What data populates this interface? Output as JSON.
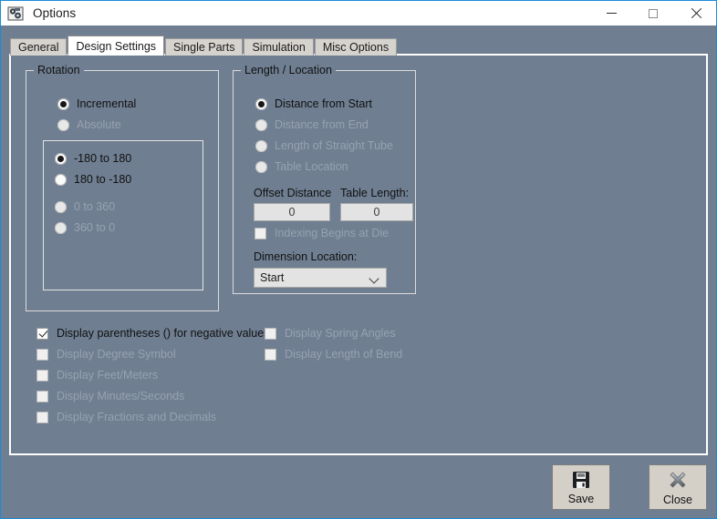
{
  "window": {
    "title": "Options",
    "icon": "machine-gear-icon",
    "controls": {
      "minimize": "minimize-icon",
      "maximize": "maximize-icon",
      "close": "close-icon"
    },
    "border_color": "#1a8cd8",
    "body_color": "#6f7e91"
  },
  "tabs": [
    {
      "label": "General",
      "active": false
    },
    {
      "label": "Design Settings",
      "active": true
    },
    {
      "label": "Single Parts",
      "active": false
    },
    {
      "label": "Simulation",
      "active": false
    },
    {
      "label": "Misc Options",
      "active": false
    }
  ],
  "rotation_group": {
    "title": "Rotation",
    "mode_radios": [
      {
        "label": "Incremental",
        "checked": true,
        "disabled": false
      },
      {
        "label": "Absolute",
        "checked": false,
        "disabled": true
      }
    ],
    "range_radios": [
      {
        "label": "-180 to  180",
        "checked": true,
        "disabled": false
      },
      {
        "label": "180 to  -180",
        "checked": false,
        "disabled": false
      },
      {
        "label": "0 to  360",
        "checked": false,
        "disabled": true
      },
      {
        "label": "360 to  0",
        "checked": false,
        "disabled": true
      }
    ]
  },
  "length_location_group": {
    "title": "Length / Location",
    "radios": [
      {
        "label": "Distance from Start",
        "checked": true,
        "disabled": false
      },
      {
        "label": "Distance from End",
        "checked": false,
        "disabled": true
      },
      {
        "label": "Length of Straight Tube",
        "checked": false,
        "disabled": true
      },
      {
        "label": "Table Location",
        "checked": false,
        "disabled": true
      }
    ],
    "offset_distance": {
      "label": "Offset Distance",
      "value": "0"
    },
    "table_length": {
      "label": "Table Length:",
      "value": "0"
    },
    "indexing_checkbox": {
      "label": "Indexing Begins at Die",
      "checked": false,
      "disabled": true
    },
    "dimension_location": {
      "label": "Dimension Location:",
      "value": "Start"
    }
  },
  "display_options_left": [
    {
      "label": "Display parentheses () for negative values",
      "checked": true,
      "disabled": false
    },
    {
      "label": "Display Degree Symbol",
      "checked": false,
      "disabled": true
    },
    {
      "label": "Display Feet/Meters",
      "checked": false,
      "disabled": true
    },
    {
      "label": "Display Minutes/Seconds",
      "checked": false,
      "disabled": true
    },
    {
      "label": "Display Fractions and Decimals",
      "checked": false,
      "disabled": true
    }
  ],
  "display_options_right": [
    {
      "label": "Display Spring Angles",
      "checked": false,
      "disabled": true
    },
    {
      "label": "Display Length of Bend",
      "checked": false,
      "disabled": true
    }
  ],
  "buttons": {
    "save": {
      "label": "Save",
      "icon": "floppy-disk-icon"
    },
    "close": {
      "label": "Close",
      "icon": "x-mark-icon"
    }
  }
}
